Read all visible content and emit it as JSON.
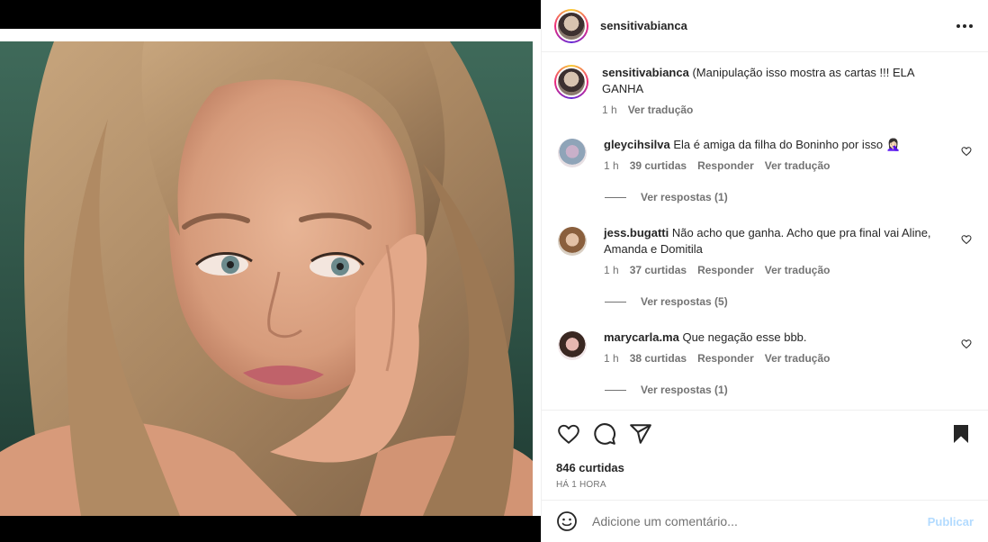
{
  "post": {
    "author": "sensitivabianca",
    "caption": {
      "username": "sensitivabianca",
      "text": "(Manipulação isso mostra as cartas !!! ELA GANHA",
      "time": "1 h",
      "translate": "Ver tradução"
    },
    "comments": [
      {
        "username": "gleycihsilva",
        "text": "Ela é amiga da filha do Boninho por isso 🤦🏻‍♀️",
        "time": "1 h",
        "likes": "39 curtidas",
        "reply": "Responder",
        "translate": "Ver tradução",
        "replies": "Ver respostas (1)"
      },
      {
        "username": "jess.bugatti",
        "text": "Não acho que ganha. Acho que pra final vai Aline, Amanda e Domitila",
        "time": "1 h",
        "likes": "37 curtidas",
        "reply": "Responder",
        "translate": "Ver tradução",
        "replies": "Ver respostas (5)"
      },
      {
        "username": "marycarla.ma",
        "text": "Que negação esse bbb.",
        "time": "1 h",
        "likes": "38 curtidas",
        "reply": "Responder",
        "translate": "Ver tradução",
        "replies": "Ver respostas (1)"
      }
    ],
    "likes_count": "846 curtidas",
    "posted_ago": "HÁ 1 HORA"
  },
  "comment_box": {
    "placeholder": "Adicione um comentário...",
    "publish": "Publicar"
  },
  "icons": [
    "more-options-icon",
    "heart-icon",
    "comment-icon",
    "share-icon",
    "bookmark-icon",
    "emoji-icon"
  ],
  "colors": {
    "accent_disabled": "#b3dbff",
    "muted": "#737373",
    "divider": "#efefef"
  }
}
